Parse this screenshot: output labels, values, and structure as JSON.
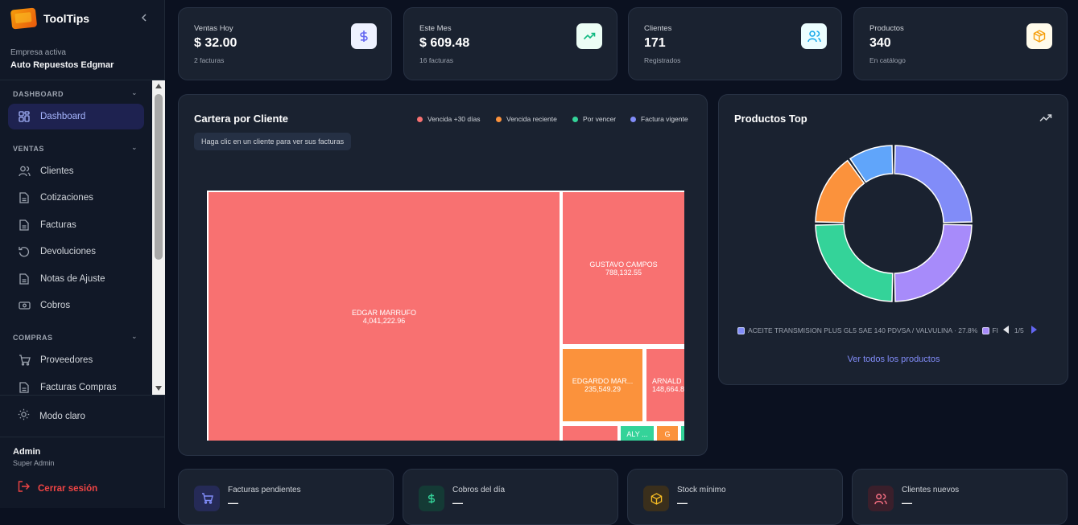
{
  "app": {
    "name": "ToolTips",
    "collapse_icon": "chevron-left-icon"
  },
  "company": {
    "caption": "Empresa activa",
    "name": "Auto Repuestos Edgmar"
  },
  "sidebar": {
    "sections": [
      {
        "label": "DASHBOARD"
      },
      {
        "label": "VENTAS"
      },
      {
        "label": "COMPRAS"
      }
    ],
    "items": [
      {
        "label": "Dashboard",
        "icon": "dashboard-icon"
      },
      {
        "label": "Clientes",
        "icon": "users-icon"
      },
      {
        "label": "Cotizaciones",
        "icon": "document-icon"
      },
      {
        "label": "Facturas",
        "icon": "document-icon"
      },
      {
        "label": "Devoluciones",
        "icon": "undo-icon"
      },
      {
        "label": "Notas de Ajuste",
        "icon": "document-icon"
      },
      {
        "label": "Cobros",
        "icon": "banknote-icon"
      },
      {
        "label": "Proveedores",
        "icon": "cart-icon"
      },
      {
        "label": "Facturas Compras",
        "icon": "document-icon"
      }
    ],
    "mode_toggle": "Modo claro",
    "user": {
      "name": "Admin",
      "role": "Super Admin"
    },
    "logout": "Cerrar sesión"
  },
  "stats": [
    {
      "caption": "Ventas Hoy",
      "value": "$ 32.00",
      "sub": "2 facturas",
      "icon": "dollar-icon",
      "color": "#6366f1"
    },
    {
      "caption": "Este Mes",
      "value": "$ 609.48",
      "sub": "16 facturas",
      "icon": "trending-up-icon",
      "color": "#10b981"
    },
    {
      "caption": "Clientes",
      "value": "171",
      "sub": "Registrados",
      "icon": "users-icon",
      "color": "#0ea5e9"
    },
    {
      "caption": "Productos",
      "value": "340",
      "sub": "En catálogo",
      "icon": "box-icon",
      "color": "#f59e0b"
    }
  ],
  "cartera": {
    "title": "Cartera por Cliente",
    "hint": "Haga clic en un cliente para ver sus facturas",
    "legend": [
      {
        "label": "Vencida +30 días",
        "color": "#f87171"
      },
      {
        "label": "Vencida reciente",
        "color": "#fb923c"
      },
      {
        "label": "Por vencer",
        "color": "#34d399"
      },
      {
        "label": "Factura vigente",
        "color": "#818cf8"
      }
    ],
    "nodes": [
      {
        "name": "EDGAR  MARRUFO",
        "value": "4,041,222.96"
      },
      {
        "name": "GUSTAVO CAMPOS",
        "value": "788,132.55"
      },
      {
        "name": "EDGARDO  MAR...",
        "value": "235,549.29"
      },
      {
        "name": "ARNALD",
        "value": "148,664.8"
      },
      {
        "name": "ALY ...",
        "value": ""
      },
      {
        "name": "G",
        "value": ""
      }
    ]
  },
  "productos_top": {
    "title": "Productos Top",
    "icon": "trending-up-icon",
    "legend_item": "ACEITE TRANSMISION PLUS GL5 SAE 140 PDVSA / VALVULINA · 27.8%",
    "legend_next": "FI",
    "page": "1/5",
    "link": "Ver todos los productos"
  },
  "bottom_cards": [
    {
      "caption": "Facturas pendientes",
      "value": "—",
      "icon": "cart-icon",
      "color": "#6366f1"
    },
    {
      "caption": "Cobros del día",
      "value": "—",
      "icon": "dollar-icon",
      "color": "#10b981"
    },
    {
      "caption": "Stock mínimo",
      "value": "—",
      "icon": "box-icon",
      "color": "#f59e0b"
    },
    {
      "caption": "Clientes nuevos",
      "value": "—",
      "icon": "users-icon",
      "color": "#f43f5e"
    }
  ]
}
